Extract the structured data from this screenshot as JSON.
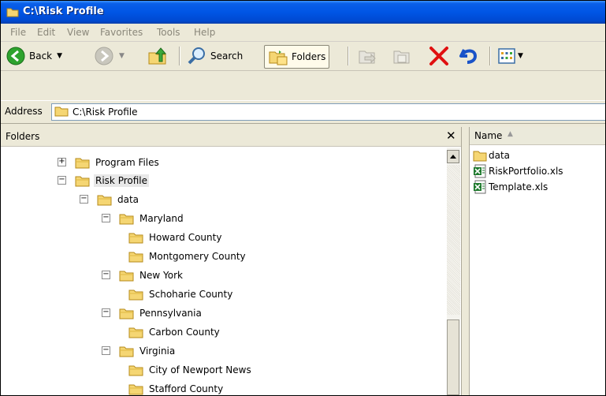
{
  "window": {
    "title": "C:\\Risk Profile"
  },
  "menu": [
    "File",
    "Edit",
    "View",
    "Favorites",
    "Tools",
    "Help"
  ],
  "toolbar": {
    "back_label": "Back",
    "search_label": "Search",
    "folders_label": "Folders"
  },
  "address": {
    "label": "Address",
    "value": "C:\\Risk Profile"
  },
  "folders_pane": {
    "title": "Folders",
    "close_glyph": "✕",
    "items": [
      {
        "label": "Program Files",
        "expander": "+"
      },
      {
        "label": "Risk Profile",
        "expander": "−"
      },
      {
        "label": "data",
        "expander": "−"
      },
      {
        "label": "Maryland",
        "expander": "−"
      },
      {
        "label": "Howard County"
      },
      {
        "label": "Montgomery County"
      },
      {
        "label": "New York",
        "expander": "−"
      },
      {
        "label": "Schoharie County"
      },
      {
        "label": "Pennsylvania",
        "expander": "−"
      },
      {
        "label": "Carbon County"
      },
      {
        "label": "Virginia",
        "expander": "−"
      },
      {
        "label": "City of Newport News"
      },
      {
        "label": "Stafford County"
      }
    ]
  },
  "files_pane": {
    "column_name": "Name",
    "sort_arrow": "▲",
    "files": [
      {
        "name": "data",
        "icon": "folder-icon"
      },
      {
        "name": "RiskPortfolio.xls",
        "icon": "excel-file-icon"
      },
      {
        "name": "Template.xls",
        "icon": "excel-file-icon"
      }
    ]
  },
  "colors": {
    "title_bar": "#0055e5",
    "folder": "#f5d673",
    "selection": "#e8e8e8",
    "delete_red": "#e01010"
  }
}
